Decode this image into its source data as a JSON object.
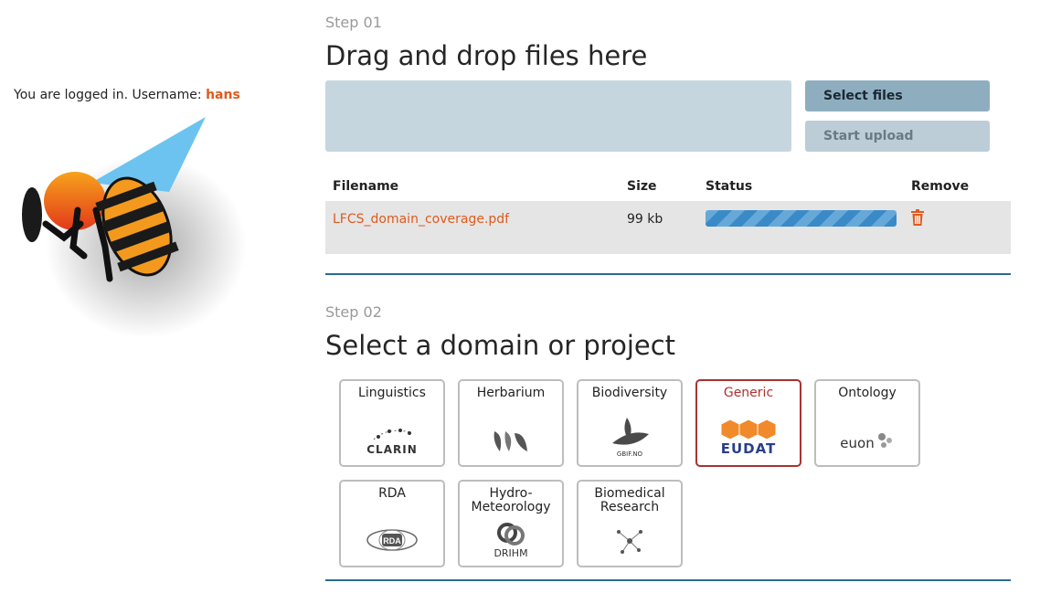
{
  "sidebar": {
    "login_prefix": "You are logged in. Username:",
    "username": "hans"
  },
  "step1": {
    "label": "Step 01",
    "heading": "Drag and drop files here",
    "select_files_label": "Select files",
    "start_upload_label": "Start upload",
    "table": {
      "headers": {
        "filename": "Filename",
        "size": "Size",
        "status": "Status",
        "remove": "Remove"
      },
      "rows": [
        {
          "filename": "LFCS_domain_coverage.pdf",
          "size": "99 kb",
          "progress": 1.0
        }
      ]
    }
  },
  "step2": {
    "label": "Step 02",
    "heading": "Select a domain or project",
    "domains": [
      {
        "label": "Linguistics",
        "logo_text": "CLARIN",
        "selected": false
      },
      {
        "label": "Herbarium",
        "logo_text": "",
        "selected": false
      },
      {
        "label": "Biodiversity",
        "logo_text": "GBIF.NO",
        "selected": false
      },
      {
        "label": "Generic",
        "logo_text": "EUDAT",
        "selected": true
      },
      {
        "label": "Ontology",
        "logo_text": "euon",
        "selected": false
      },
      {
        "label": "RDA",
        "logo_text": "RDA",
        "selected": false
      },
      {
        "label": "Hydro-\nMeteorology",
        "logo_text": "DRIHM",
        "selected": false
      },
      {
        "label": "Biomedical\nResearch",
        "logo_text": "",
        "selected": false
      }
    ]
  },
  "colors": {
    "accent_orange": "#e05a1c",
    "divider_blue": "#2b6a94",
    "selected_border": "#a83232"
  }
}
